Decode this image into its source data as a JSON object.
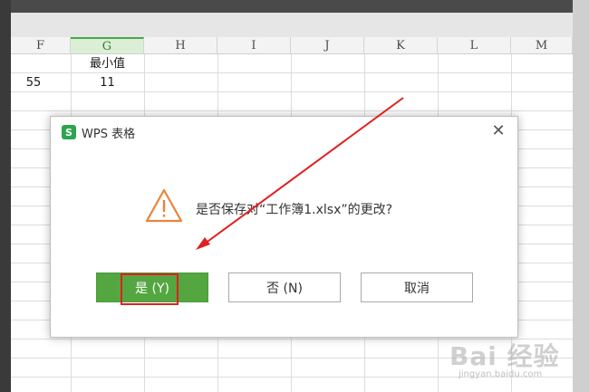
{
  "columns": [
    {
      "label": "F"
    },
    {
      "label": "G",
      "selected": true
    },
    {
      "label": "H"
    },
    {
      "label": "I"
    },
    {
      "label": "J"
    },
    {
      "label": "K"
    },
    {
      "label": "L"
    },
    {
      "label": "M"
    }
  ],
  "cells": {
    "g1": "最小值",
    "f2": "55",
    "g2": "11"
  },
  "dialog": {
    "app_title": "WPS 表格",
    "logo_letter": "S",
    "close_symbol": "✕",
    "message": "是否保存对“工作簿1.xlsx”的更改?",
    "yes_label": "是 (Y)",
    "no_label": "否 (N)",
    "cancel_label": "取消"
  },
  "colors": {
    "primary_button": "#54a640",
    "warning_icon": "#e8843a",
    "annotation": "#e02020"
  },
  "watermark": {
    "text": "Bai 经验",
    "url": "jingyan.baidu.com"
  }
}
